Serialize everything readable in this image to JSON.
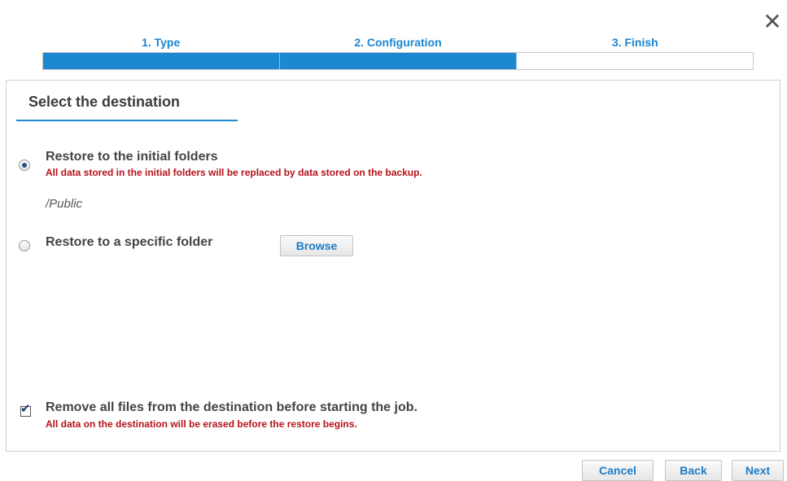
{
  "dialog": {
    "close_glyph": "✕"
  },
  "steps": [
    {
      "label": "1. Type",
      "state": "done"
    },
    {
      "label": "2. Configuration",
      "state": "done"
    },
    {
      "label": "3. Finish",
      "state": "todo"
    }
  ],
  "section": {
    "title": "Select the destination"
  },
  "options": {
    "initial": {
      "label": "Restore to the initial folders",
      "warning": "All data stored in the initial folders will be replaced by data stored on the backup.",
      "path": "/Public",
      "selected": true
    },
    "specific": {
      "label": "Restore to a specific folder",
      "browse_label": "Browse",
      "selected": false
    }
  },
  "remove_files": {
    "label": "Remove all files from the destination before starting the job.",
    "warning": "All data on the destination will be erased before the restore begins.",
    "checked": true,
    "check_glyph": "✔"
  },
  "footer": {
    "cancel_label": "Cancel",
    "back_label": "Back",
    "next_label": "Next"
  },
  "colors": {
    "accent": "#1c88d2",
    "warning": "#b5121b"
  }
}
